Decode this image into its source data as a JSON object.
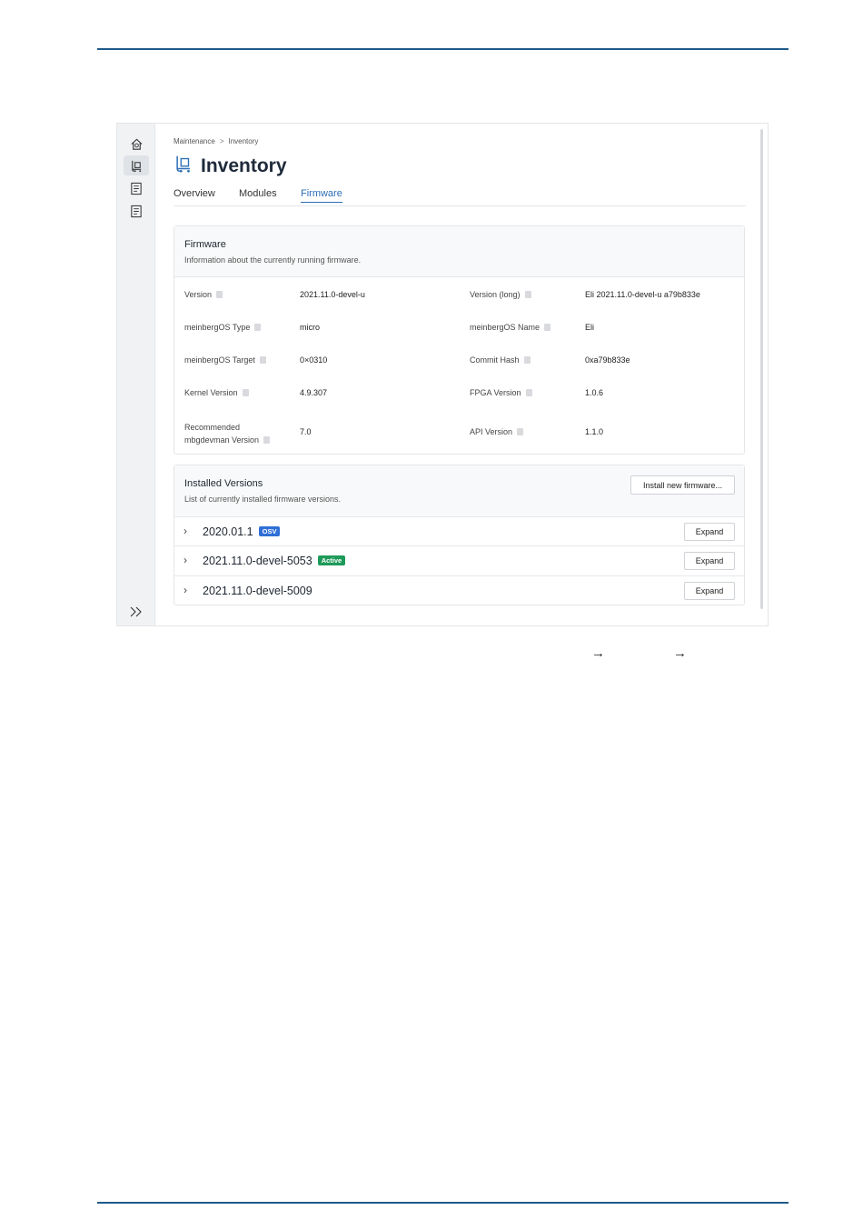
{
  "breadcrumb": [
    "Maintenance",
    "Inventory"
  ],
  "page_title": "Inventory",
  "tabs": [
    "Overview",
    "Modules",
    "Firmware"
  ],
  "firmware": {
    "title": "Firmware",
    "subtitle": "Information about the currently running firmware.",
    "fields": [
      {
        "label": "Version",
        "value": "2021.11.0-devel-u"
      },
      {
        "label": "Version (long)",
        "value": "Eli 2021.11.0-devel-u a79b833e"
      },
      {
        "label": "meinbergOS Type",
        "value": "micro"
      },
      {
        "label": "meinbergOS Name",
        "value": "Eli"
      },
      {
        "label": "meinbergOS Target",
        "value": "0×0310"
      },
      {
        "label": "Commit Hash",
        "value": "0xa79b833e"
      },
      {
        "label": "Kernel Version",
        "value": "4.9.307"
      },
      {
        "label": "FPGA Version",
        "value": "1.0.6"
      },
      {
        "label_line1": "Recommended",
        "label_line2": "mbgdevman Version",
        "value": "7.0"
      },
      {
        "label": "API Version",
        "value": "1.1.0"
      }
    ]
  },
  "installed": {
    "title": "Installed Versions",
    "subtitle": "List of currently installed firmware versions.",
    "install_button": "Install new firmware...",
    "versions": [
      {
        "name": "2020.01.1",
        "badge": "OSV",
        "badge_color": "#2f6fd6"
      },
      {
        "name": "2021.11.0-devel-5053",
        "badge": "Active",
        "badge_color": "#1e9a5a"
      },
      {
        "name": "2021.11.0-devel-5009"
      }
    ],
    "expand_label": "Expand"
  },
  "arrows": [
    "→",
    "→"
  ],
  "colors": {
    "accent": "#2e6fb5",
    "rule": "#1e5a8c"
  }
}
